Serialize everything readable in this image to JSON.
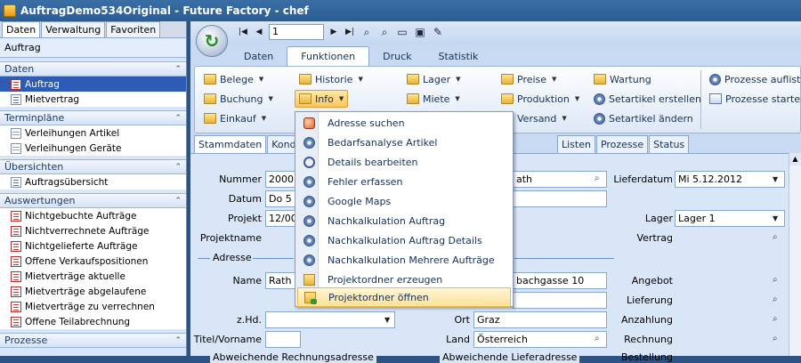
{
  "window": {
    "title": "AuftragDemo534Original - Future Factory - chef"
  },
  "left_panel": {
    "tabs": [
      "Daten",
      "Verwaltung",
      "Favoriten"
    ],
    "header": "Auftrag",
    "sections": [
      {
        "title": "Daten",
        "items": [
          "Auftrag",
          "Mietvertrag"
        ]
      },
      {
        "title": "Terminpläne",
        "items": [
          "Verleihungen Artikel",
          "Verleihungen Geräte"
        ]
      },
      {
        "title": "Übersichten",
        "items": [
          "Auftragsübersicht"
        ]
      },
      {
        "title": "Auswertungen",
        "items": [
          "Nichtgebuchte Aufträge",
          "Nichtverrechnete Aufträge",
          "Nichtgelieferte Aufträge",
          "Offene Verkaufspositionen",
          "Mietverträge aktuelle",
          "Mietverträge abgelaufene",
          "Mietverträge zu verrechnen",
          "Offene Teilabrechnung"
        ]
      },
      {
        "title": "Prozesse",
        "items": []
      }
    ]
  },
  "navbar": {
    "record": "1"
  },
  "ribbon_tabs": [
    "Daten",
    "Funktionen",
    "Druck",
    "Statistik"
  ],
  "ribbon": {
    "col1": [
      "Belege",
      "Buchung",
      "Einkauf"
    ],
    "col2": [
      "Historie",
      "Info"
    ],
    "col3": [
      "Lager",
      "Miete"
    ],
    "col4": [
      "Preise",
      "Produktion",
      "Versand"
    ],
    "col5": [
      "Wartung",
      "Setartikel erstellen",
      "Setartikel ändern"
    ],
    "col6": [
      "Prozesse aufliste",
      "Prozesse starten"
    ]
  },
  "form_tabs": [
    "Stammdaten",
    "Kondit",
    "Listen",
    "Prozesse",
    "Status"
  ],
  "form": {
    "labels": {
      "nummer": "Nummer",
      "datum": "Datum",
      "projekt": "Projekt",
      "projektname": "Projektname",
      "adresse_group": "Adresse",
      "name": "Name",
      "zhd": "z.Hd.",
      "titel": "Titel/Vorname",
      "ort": "Ort",
      "land": "Land",
      "lieferdatum": "Lieferdatum",
      "lager": "Lager",
      "vertrag": "Vertrag",
      "angebot": "Angebot",
      "lieferung": "Lieferung",
      "anzahlung": "Anzahlung",
      "rechnung": "Rechnung",
      "abw_rechnung": "Abweichende Rechnungsadresse",
      "abw_liefer": "Abweichende Lieferadresse",
      "bestellung": "Bestellung"
    },
    "values": {
      "nummer": "20001",
      "datum": "Do 5",
      "projekt": "12/00",
      "name": "Rath &",
      "kunde": "ath",
      "strasse": "bachgasse 10",
      "ort": "Graz",
      "land": "Österreich",
      "lieferdatum": "Mi 5.12.2012",
      "lager": "Lager 1"
    }
  },
  "menu": {
    "items": [
      {
        "label": "Adresse suchen",
        "icon": "person-icon"
      },
      {
        "label": "Bedarfsanalyse Artikel",
        "icon": "gear-icon"
      },
      {
        "label": "Details bearbeiten",
        "icon": "zoom-icon"
      },
      {
        "label": "Fehler erfassen",
        "icon": "gear-icon"
      },
      {
        "label": "Google Maps",
        "icon": "gear-icon"
      },
      {
        "label": "Nachkalkulation Auftrag",
        "icon": "gear-icon"
      },
      {
        "label": "Nachkalkulation Auftrag Details",
        "icon": "gear-icon"
      },
      {
        "label": "Nachkalkulation Mehrere Aufträge",
        "icon": "gear-icon"
      },
      {
        "label": "Projektordner erzeugen",
        "icon": "folder-icon"
      },
      {
        "label": "Projektordner öffnen",
        "icon": "folder-go-icon"
      }
    ],
    "highlighted": "Projektordner öffnen"
  },
  "colors": {
    "accent": "#2d5bb5",
    "highlight": "#ffe29a",
    "panel": "#d9e6f7"
  }
}
